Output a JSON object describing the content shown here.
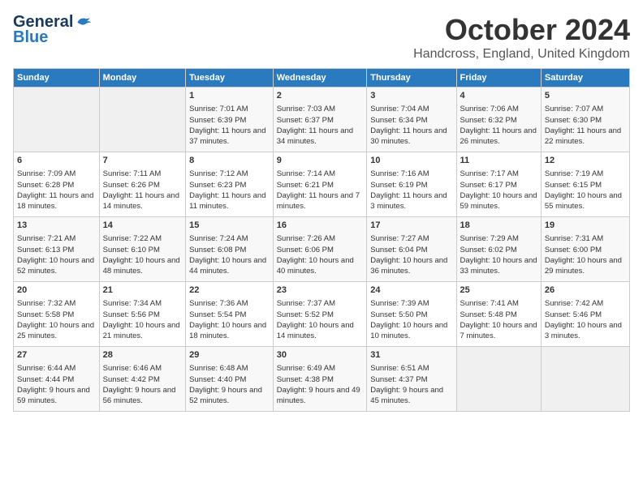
{
  "logo": {
    "general": "General",
    "blue": "Blue"
  },
  "title": "October 2024",
  "location": "Handcross, England, United Kingdom",
  "days_of_week": [
    "Sunday",
    "Monday",
    "Tuesday",
    "Wednesday",
    "Thursday",
    "Friday",
    "Saturday"
  ],
  "weeks": [
    [
      {
        "day": "",
        "sunrise": "",
        "sunset": "",
        "daylight": "",
        "empty": true
      },
      {
        "day": "",
        "sunrise": "",
        "sunset": "",
        "daylight": "",
        "empty": true
      },
      {
        "day": "1",
        "sunrise": "Sunrise: 7:01 AM",
        "sunset": "Sunset: 6:39 PM",
        "daylight": "Daylight: 11 hours and 37 minutes."
      },
      {
        "day": "2",
        "sunrise": "Sunrise: 7:03 AM",
        "sunset": "Sunset: 6:37 PM",
        "daylight": "Daylight: 11 hours and 34 minutes."
      },
      {
        "day": "3",
        "sunrise": "Sunrise: 7:04 AM",
        "sunset": "Sunset: 6:34 PM",
        "daylight": "Daylight: 11 hours and 30 minutes."
      },
      {
        "day": "4",
        "sunrise": "Sunrise: 7:06 AM",
        "sunset": "Sunset: 6:32 PM",
        "daylight": "Daylight: 11 hours and 26 minutes."
      },
      {
        "day": "5",
        "sunrise": "Sunrise: 7:07 AM",
        "sunset": "Sunset: 6:30 PM",
        "daylight": "Daylight: 11 hours and 22 minutes."
      }
    ],
    [
      {
        "day": "6",
        "sunrise": "Sunrise: 7:09 AM",
        "sunset": "Sunset: 6:28 PM",
        "daylight": "Daylight: 11 hours and 18 minutes."
      },
      {
        "day": "7",
        "sunrise": "Sunrise: 7:11 AM",
        "sunset": "Sunset: 6:26 PM",
        "daylight": "Daylight: 11 hours and 14 minutes."
      },
      {
        "day": "8",
        "sunrise": "Sunrise: 7:12 AM",
        "sunset": "Sunset: 6:23 PM",
        "daylight": "Daylight: 11 hours and 11 minutes."
      },
      {
        "day": "9",
        "sunrise": "Sunrise: 7:14 AM",
        "sunset": "Sunset: 6:21 PM",
        "daylight": "Daylight: 11 hours and 7 minutes."
      },
      {
        "day": "10",
        "sunrise": "Sunrise: 7:16 AM",
        "sunset": "Sunset: 6:19 PM",
        "daylight": "Daylight: 11 hours and 3 minutes."
      },
      {
        "day": "11",
        "sunrise": "Sunrise: 7:17 AM",
        "sunset": "Sunset: 6:17 PM",
        "daylight": "Daylight: 10 hours and 59 minutes."
      },
      {
        "day": "12",
        "sunrise": "Sunrise: 7:19 AM",
        "sunset": "Sunset: 6:15 PM",
        "daylight": "Daylight: 10 hours and 55 minutes."
      }
    ],
    [
      {
        "day": "13",
        "sunrise": "Sunrise: 7:21 AM",
        "sunset": "Sunset: 6:13 PM",
        "daylight": "Daylight: 10 hours and 52 minutes."
      },
      {
        "day": "14",
        "sunrise": "Sunrise: 7:22 AM",
        "sunset": "Sunset: 6:10 PM",
        "daylight": "Daylight: 10 hours and 48 minutes."
      },
      {
        "day": "15",
        "sunrise": "Sunrise: 7:24 AM",
        "sunset": "Sunset: 6:08 PM",
        "daylight": "Daylight: 10 hours and 44 minutes."
      },
      {
        "day": "16",
        "sunrise": "Sunrise: 7:26 AM",
        "sunset": "Sunset: 6:06 PM",
        "daylight": "Daylight: 10 hours and 40 minutes."
      },
      {
        "day": "17",
        "sunrise": "Sunrise: 7:27 AM",
        "sunset": "Sunset: 6:04 PM",
        "daylight": "Daylight: 10 hours and 36 minutes."
      },
      {
        "day": "18",
        "sunrise": "Sunrise: 7:29 AM",
        "sunset": "Sunset: 6:02 PM",
        "daylight": "Daylight: 10 hours and 33 minutes."
      },
      {
        "day": "19",
        "sunrise": "Sunrise: 7:31 AM",
        "sunset": "Sunset: 6:00 PM",
        "daylight": "Daylight: 10 hours and 29 minutes."
      }
    ],
    [
      {
        "day": "20",
        "sunrise": "Sunrise: 7:32 AM",
        "sunset": "Sunset: 5:58 PM",
        "daylight": "Daylight: 10 hours and 25 minutes."
      },
      {
        "day": "21",
        "sunrise": "Sunrise: 7:34 AM",
        "sunset": "Sunset: 5:56 PM",
        "daylight": "Daylight: 10 hours and 21 minutes."
      },
      {
        "day": "22",
        "sunrise": "Sunrise: 7:36 AM",
        "sunset": "Sunset: 5:54 PM",
        "daylight": "Daylight: 10 hours and 18 minutes."
      },
      {
        "day": "23",
        "sunrise": "Sunrise: 7:37 AM",
        "sunset": "Sunset: 5:52 PM",
        "daylight": "Daylight: 10 hours and 14 minutes."
      },
      {
        "day": "24",
        "sunrise": "Sunrise: 7:39 AM",
        "sunset": "Sunset: 5:50 PM",
        "daylight": "Daylight: 10 hours and 10 minutes."
      },
      {
        "day": "25",
        "sunrise": "Sunrise: 7:41 AM",
        "sunset": "Sunset: 5:48 PM",
        "daylight": "Daylight: 10 hours and 7 minutes."
      },
      {
        "day": "26",
        "sunrise": "Sunrise: 7:42 AM",
        "sunset": "Sunset: 5:46 PM",
        "daylight": "Daylight: 10 hours and 3 minutes."
      }
    ],
    [
      {
        "day": "27",
        "sunrise": "Sunrise: 6:44 AM",
        "sunset": "Sunset: 4:44 PM",
        "daylight": "Daylight: 9 hours and 59 minutes."
      },
      {
        "day": "28",
        "sunrise": "Sunrise: 6:46 AM",
        "sunset": "Sunset: 4:42 PM",
        "daylight": "Daylight: 9 hours and 56 minutes."
      },
      {
        "day": "29",
        "sunrise": "Sunrise: 6:48 AM",
        "sunset": "Sunset: 4:40 PM",
        "daylight": "Daylight: 9 hours and 52 minutes."
      },
      {
        "day": "30",
        "sunrise": "Sunrise: 6:49 AM",
        "sunset": "Sunset: 4:38 PM",
        "daylight": "Daylight: 9 hours and 49 minutes."
      },
      {
        "day": "31",
        "sunrise": "Sunrise: 6:51 AM",
        "sunset": "Sunset: 4:37 PM",
        "daylight": "Daylight: 9 hours and 45 minutes."
      },
      {
        "day": "",
        "sunrise": "",
        "sunset": "",
        "daylight": "",
        "empty": true
      },
      {
        "day": "",
        "sunrise": "",
        "sunset": "",
        "daylight": "",
        "empty": true
      }
    ]
  ]
}
